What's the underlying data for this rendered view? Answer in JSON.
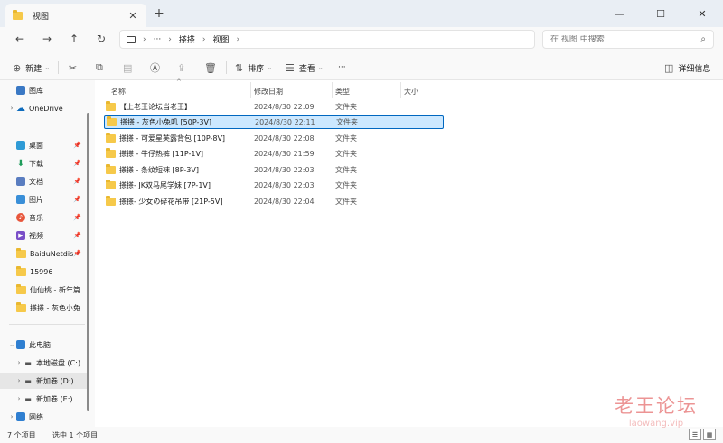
{
  "tab": {
    "title": "视图",
    "close": "✕",
    "new_tab": "+"
  },
  "window_controls": {
    "minimize": "—",
    "maximize": "☐",
    "close": "✕"
  },
  "nav": {
    "back": "←",
    "forward": "→",
    "up": "↑",
    "refresh": "↻"
  },
  "address": {
    "ellipsis": "···",
    "crumbs": [
      "搽搽",
      "视图"
    ],
    "sep": "›"
  },
  "search": {
    "placeholder": "在 视图 中搜索"
  },
  "toolbar": {
    "new_label": "新建",
    "sort_label": "排序",
    "view_label": "查看",
    "more": "···",
    "details_label": "详细信息"
  },
  "sidebar": {
    "items": [
      {
        "label": "图库",
        "icon": "gallery-icon",
        "color": "#3a78c4"
      },
      {
        "label": "OneDrive",
        "icon": "cloud-icon",
        "color": "#0f6cbd"
      },
      {
        "label": "桌面",
        "icon": "desktop-icon",
        "color": "#2f9bd6"
      },
      {
        "label": "下载",
        "icon": "download-icon",
        "color": "#1e9c5a"
      },
      {
        "label": "文档",
        "icon": "document-icon",
        "color": "#5a7dc0"
      },
      {
        "label": "图片",
        "icon": "picture-icon",
        "color": "#3a8fd8"
      },
      {
        "label": "音乐",
        "icon": "music-icon",
        "color": "#e8563c"
      },
      {
        "label": "视频",
        "icon": "video-icon",
        "color": "#7a4fc8"
      },
      {
        "label": "BaiduNetdis",
        "icon": "folder-icon",
        "color": "#f6c94a"
      },
      {
        "label": "15996",
        "icon": "folder-icon",
        "color": "#f6c94a"
      },
      {
        "label": "仙仙桃 - 新年篇",
        "icon": "folder-icon",
        "color": "#f6c94a"
      },
      {
        "label": "搽搽 - 灰色小兔",
        "icon": "folder-icon",
        "color": "#f6c94a"
      },
      {
        "label": "此电脑",
        "icon": "computer-icon",
        "color": "#2f7fd1"
      },
      {
        "label": "本地磁盘 (C:)",
        "icon": "drive-icon",
        "color": "#555555"
      },
      {
        "label": "新加卷 (D:)",
        "icon": "drive-icon",
        "color": "#555555"
      },
      {
        "label": "新加卷 (E:)",
        "icon": "drive-icon",
        "color": "#555555"
      },
      {
        "label": "网络",
        "icon": "network-icon",
        "color": "#2f7fd1"
      }
    ]
  },
  "columns": {
    "name": "名称",
    "date": "修改日期",
    "type": "类型",
    "size": "大小"
  },
  "files": [
    {
      "name": "【上老王论坛当老王】",
      "date": "2024/8/30 22:09",
      "type": "文件夹"
    },
    {
      "name": "搽搽 - 灰色小兔叽 [50P-3V]",
      "date": "2024/8/30 22:11",
      "type": "文件夹"
    },
    {
      "name": "搽搽 - 可爱星芙露背包 [10P-8V]",
      "date": "2024/8/30 22:08",
      "type": "文件夹"
    },
    {
      "name": "搽搽 - 牛仔热裤 [11P-1V]",
      "date": "2024/8/30 21:59",
      "type": "文件夹"
    },
    {
      "name": "搽搽 - 条纹短袜 [8P-3V]",
      "date": "2024/8/30 22:03",
      "type": "文件夹"
    },
    {
      "name": "搽搽- JK双马尾学妹 [7P-1V]",
      "date": "2024/8/30 22:03",
      "type": "文件夹"
    },
    {
      "name": "搽搽- 少女の碎花吊带 [21P-5V]",
      "date": "2024/8/30 22:04",
      "type": "文件夹"
    }
  ],
  "status": {
    "count": "7 个项目",
    "selected": "选中 1 个项目"
  },
  "watermark": {
    "line1": "老王论坛",
    "line2": "laowang.vip"
  },
  "colors": {
    "accent": "#0067c0",
    "selection": "#cce8ff",
    "folder": "#f6c94a"
  }
}
